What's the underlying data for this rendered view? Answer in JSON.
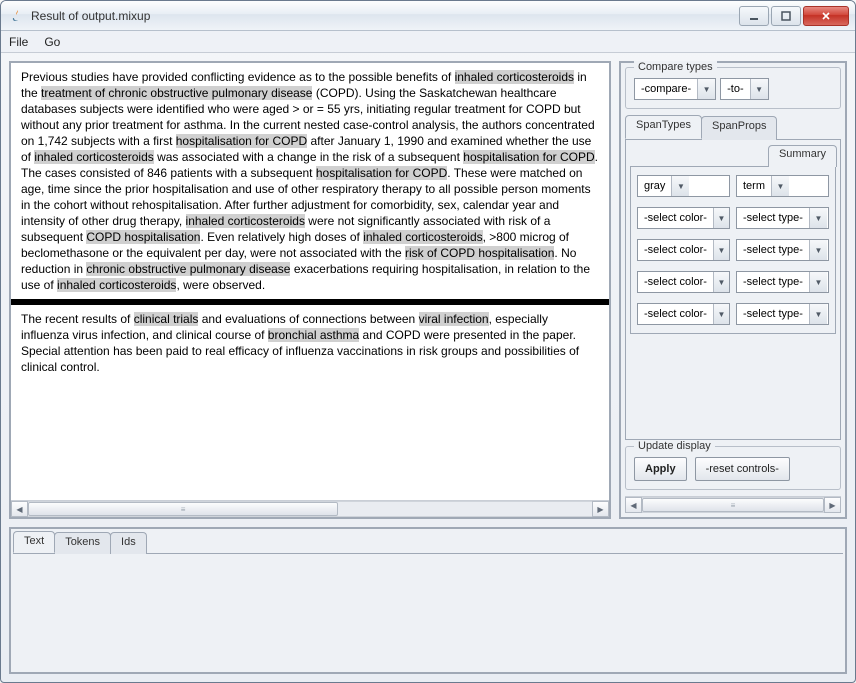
{
  "window": {
    "title": "Result of output.mixup"
  },
  "menu": {
    "file": "File",
    "go": "Go"
  },
  "documents": [
    {
      "segments": [
        {
          "t": "Previous studies have provided conflicting evidence as to the possible benefits of ",
          "hl": false
        },
        {
          "t": "inhaled corticosteroids",
          "hl": true
        },
        {
          "t": " in the ",
          "hl": false
        },
        {
          "t": "treatment of chronic obstructive pulmonary disease",
          "hl": true
        },
        {
          "t": " (COPD). Using the Saskatchewan healthcare databases subjects were identified who were aged > or = 55 yrs, initiating regular treatment for COPD but without any prior treatment for asthma. In the current nested case-control analysis, the authors concentrated on 1,742 subjects with a first ",
          "hl": false
        },
        {
          "t": "hospitalisation for COPD",
          "hl": true
        },
        {
          "t": " after January 1, 1990 and examined whether the use of ",
          "hl": false
        },
        {
          "t": "inhaled corticosteroids",
          "hl": true
        },
        {
          "t": " was associated with a change in the risk of a subsequent ",
          "hl": false
        },
        {
          "t": "hospitalisation for COPD",
          "hl": true
        },
        {
          "t": ". The cases consisted of 846 patients with a subsequent ",
          "hl": false
        },
        {
          "t": "hospitalisation for COPD",
          "hl": true
        },
        {
          "t": ". These were matched on age, time since the prior hospitalisation and use of other respiratory therapy to all possible person moments in the cohort without rehospitalisation. After further adjustment for comorbidity, sex, calendar year and intensity of other drug therapy, ",
          "hl": false
        },
        {
          "t": "inhaled corticosteroids",
          "hl": true
        },
        {
          "t": " were not significantly associated with risk of a subsequent ",
          "hl": false
        },
        {
          "t": "COPD hospitalisation",
          "hl": true
        },
        {
          "t": ". Even relatively high doses of ",
          "hl": false
        },
        {
          "t": "inhaled corticosteroids",
          "hl": true
        },
        {
          "t": ", >800 microg of beclomethasone or the equivalent per day, were not associated with the ",
          "hl": false
        },
        {
          "t": "risk of COPD hospitalisation",
          "hl": true
        },
        {
          "t": ". No reduction in ",
          "hl": false
        },
        {
          "t": "chronic obstructive pulmonary disease",
          "hl": true
        },
        {
          "t": " exacerbations requiring hospitalisation, in relation to the use of ",
          "hl": false
        },
        {
          "t": "inhaled corticosteroids",
          "hl": true
        },
        {
          "t": ", were observed.",
          "hl": false
        }
      ]
    },
    {
      "segments": [
        {
          "t": "The recent results of ",
          "hl": false
        },
        {
          "t": "clinical trials",
          "hl": true
        },
        {
          "t": " and evaluations of connections between ",
          "hl": false
        },
        {
          "t": "viral infection",
          "hl": true
        },
        {
          "t": ", especially influenza virus infection, and clinical course of ",
          "hl": false
        },
        {
          "t": "bronchial asthma",
          "hl": true
        },
        {
          "t": " and COPD were presented in the paper. Special attention has been paid to real efficacy of influenza vaccinations in risk groups and possibilities of clinical control.",
          "hl": false
        }
      ]
    }
  ],
  "compare": {
    "legend": "Compare types",
    "left": "-compare-",
    "right": "-to-"
  },
  "spantabs": {
    "types": "SpanTypes",
    "props": "SpanProps",
    "summary": "Summary"
  },
  "selectors": {
    "rows": [
      {
        "color": "gray",
        "type": "term"
      },
      {
        "color": "-select color-",
        "type": "-select type-"
      },
      {
        "color": "-select color-",
        "type": "-select type-"
      },
      {
        "color": "-select color-",
        "type": "-select type-"
      },
      {
        "color": "-select color-",
        "type": "-select type-"
      }
    ]
  },
  "update": {
    "legend": "Update display",
    "apply": "Apply",
    "reset": "-reset controls-"
  },
  "bottom_tabs": {
    "text": "Text",
    "tokens": "Tokens",
    "ids": "Ids"
  }
}
